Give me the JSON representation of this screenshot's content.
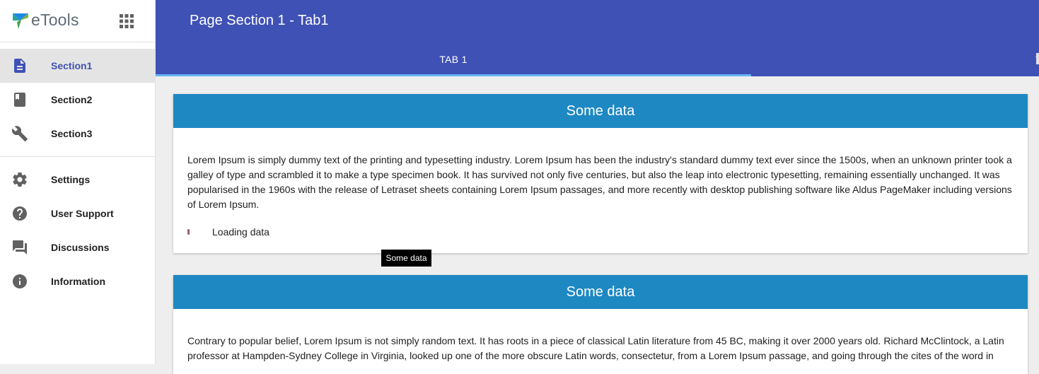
{
  "app": {
    "brand": "eTools"
  },
  "sidebar": {
    "items": [
      {
        "label": "Section1",
        "icon": "description-icon",
        "active": true
      },
      {
        "label": "Section2",
        "icon": "book-icon",
        "active": false
      },
      {
        "label": "Section3",
        "icon": "wrench-icon",
        "active": false
      }
    ],
    "secondary": [
      {
        "label": "Settings",
        "icon": "gear-icon"
      },
      {
        "label": "User Support",
        "icon": "help-icon"
      },
      {
        "label": "Discussions",
        "icon": "forum-icon"
      },
      {
        "label": "Information",
        "icon": "info-icon"
      }
    ]
  },
  "header": {
    "title": "Page Section 1 - Tab1",
    "tabs": [
      {
        "label": "TAB 1",
        "active": true
      },
      {
        "label": "T",
        "active": false
      }
    ]
  },
  "cards": [
    {
      "title": "Some data",
      "text": "Lorem Ipsum is simply dummy text of the printing and typesetting industry. Lorem Ipsum has been the industry's standard dummy text ever since the 1500s, when an unknown printer took a galley of type and scrambled it to make a type specimen book. It has survived not only five centuries, but also the leap into electronic typesetting, remaining essentially unchanged. It was popularised in the 1960s with the release of Letraset sheets containing Lorem Ipsum passages, and more recently with desktop publishing software like Aldus PageMaker including versions of Lorem Ipsum.",
      "loading": "Loading data"
    },
    {
      "title": "Some data",
      "text": "Contrary to popular belief, Lorem Ipsum is not simply random text. It has roots in a piece of classical Latin literature from 45 BC, making it over 2000 years old. Richard McClintock, a Latin professor at Hampden-Sydney College in Virginia, looked up one of the more obscure Latin words, consectetur, from a Lorem Ipsum passage, and going through the cites of the word in"
    }
  ],
  "tooltip": "Some data",
  "colors": {
    "primary": "#3f51b5",
    "card_header": "#1e88c3",
    "tab_indicator": "#64b5f6"
  }
}
